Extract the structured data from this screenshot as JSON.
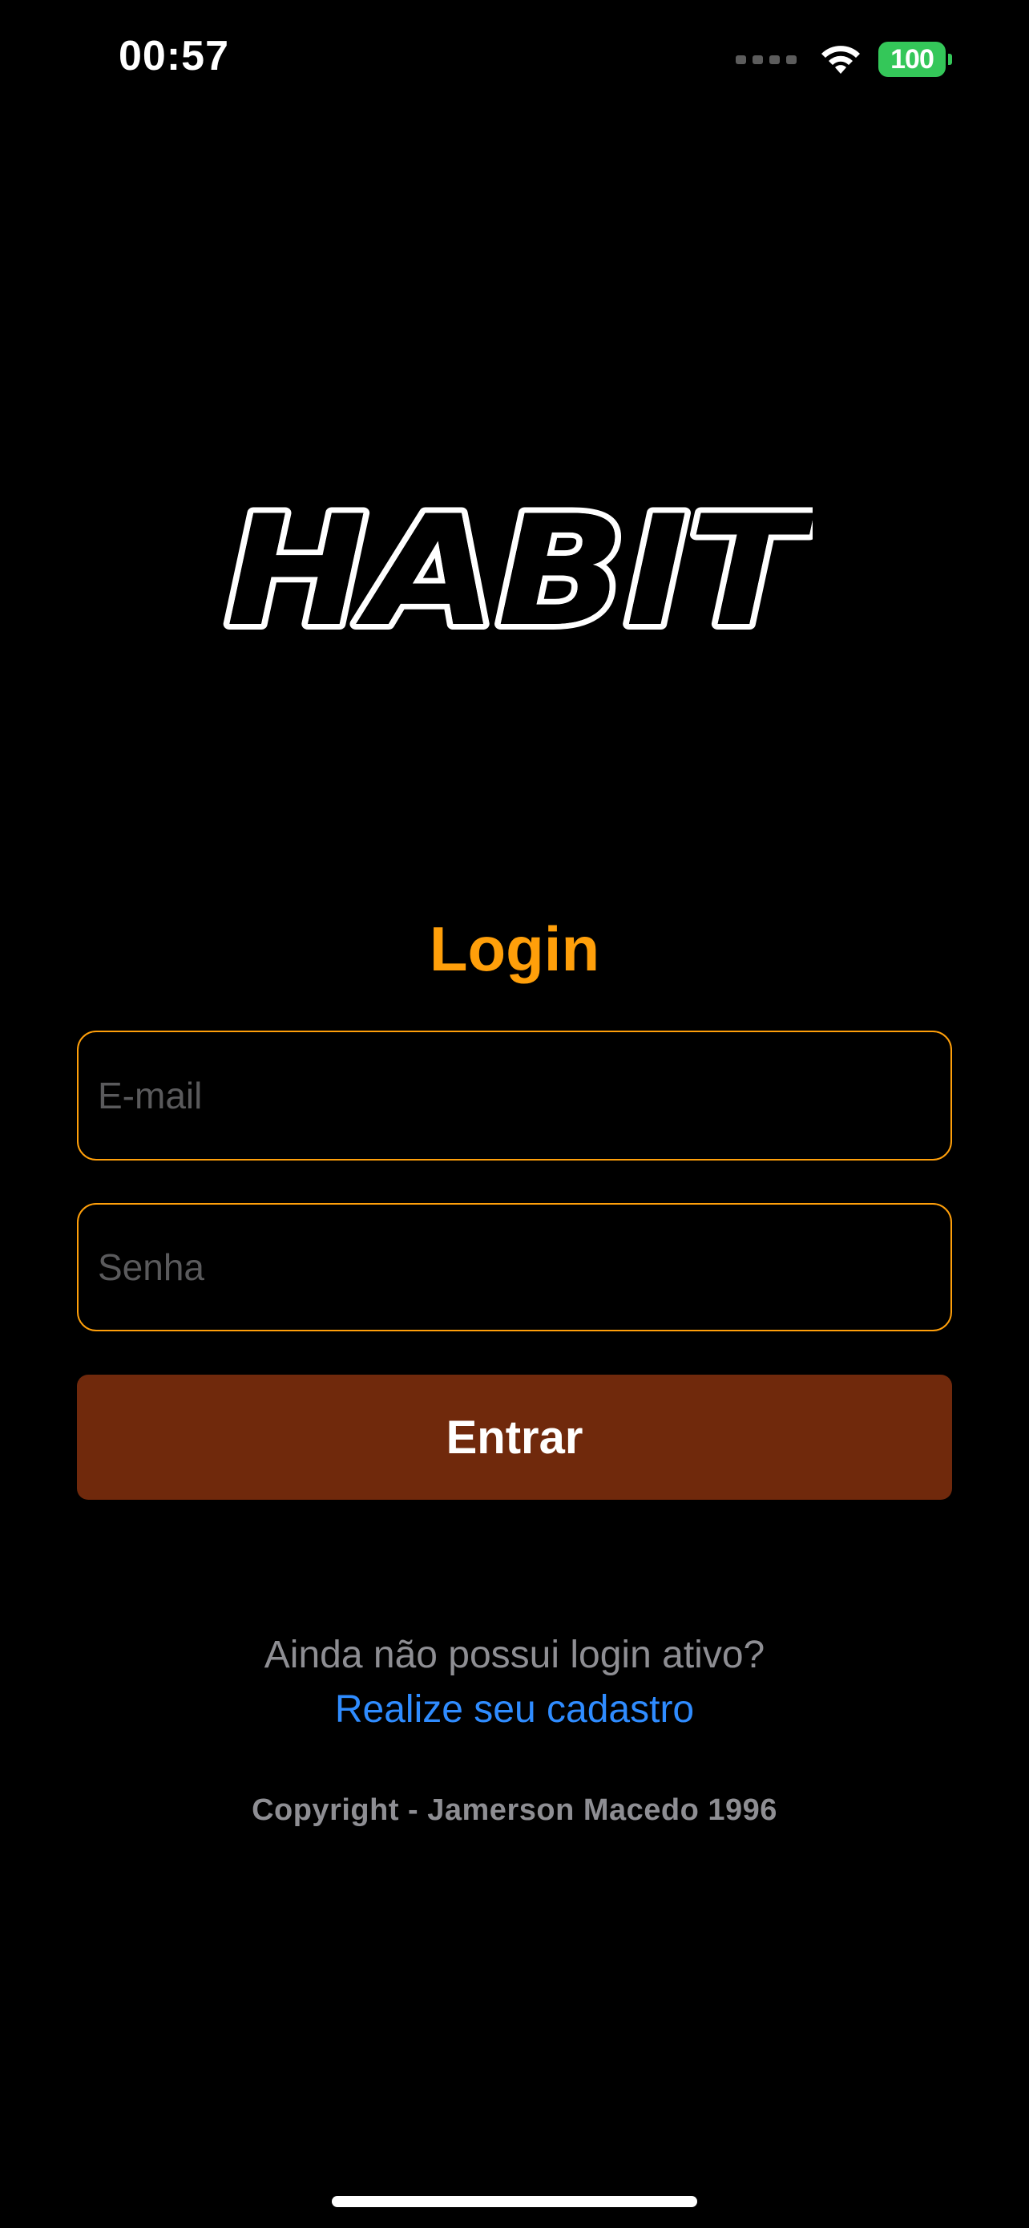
{
  "status_bar": {
    "time": "00:57",
    "battery_level": "100",
    "icons": [
      "cellular-signal-icon",
      "wifi-icon",
      "battery-icon"
    ]
  },
  "logo": {
    "text": "HABIT"
  },
  "login": {
    "title": "Login",
    "email_placeholder": "E-mail",
    "email_value": "",
    "password_placeholder": "Senha",
    "password_value": "",
    "submit_label": "Entrar"
  },
  "signup": {
    "question": "Ainda não possui login ativo?",
    "link_label": "Realize seu cadastro"
  },
  "footer": {
    "copyright": "Copyright - Jamerson Macedo 1996"
  },
  "colors": {
    "background": "#000000",
    "accent": "#ff9f0a",
    "button": "#70290c",
    "link": "#2f8cff",
    "muted_text": "#8e8e93",
    "battery": "#34c759"
  }
}
